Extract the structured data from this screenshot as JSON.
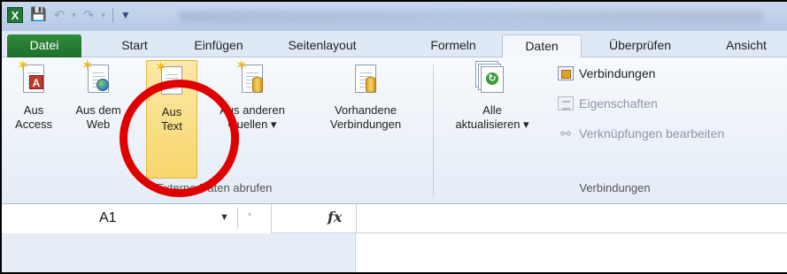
{
  "titlebar": {
    "app_icon": "excel-icon",
    "save_icon": "save-icon",
    "undo_icon": "undo-icon",
    "redo_icon": "redo-icon",
    "customize_icon": "customize-qat-icon"
  },
  "tabs": [
    {
      "label": "Datei"
    },
    {
      "label": "Start"
    },
    {
      "label": "Einfügen"
    },
    {
      "label": "Seitenlayout"
    },
    {
      "label": "Formeln"
    },
    {
      "label": "Daten"
    },
    {
      "label": "Überprüfen"
    },
    {
      "label": "Ansicht"
    }
  ],
  "ribbon": {
    "external_group": {
      "label": "Externe Daten abrufen",
      "buttons": [
        {
          "line1": "Aus",
          "line2": "Access",
          "icon": "access-db-icon"
        },
        {
          "line1": "Aus dem",
          "line2": "Web",
          "icon": "web-icon"
        },
        {
          "line1": "Aus",
          "line2": "Text",
          "icon": "text-file-icon"
        },
        {
          "line1": "Aus anderen",
          "line2": "Quellen ▾",
          "icon": "other-sources-icon"
        },
        {
          "line1": "Vorhandene",
          "line2": "Verbindungen",
          "icon": "existing-connections-icon"
        }
      ]
    },
    "connections_group": {
      "label": "Verbindungen",
      "refresh": {
        "line1": "Alle",
        "line2": "aktualisieren ▾",
        "icon": "refresh-all-icon"
      },
      "small_buttons": [
        {
          "label": "Verbindungen",
          "icon": "connections-icon",
          "enabled": true
        },
        {
          "label": "Eigenschaften",
          "icon": "properties-icon",
          "enabled": false
        },
        {
          "label": "Verknüpfungen bearbeiten",
          "icon": "edit-links-icon",
          "enabled": false
        }
      ]
    }
  },
  "formula_bar": {
    "name_box": "A1",
    "fx": "fx",
    "formula": ""
  },
  "colors": {
    "file_tab": "#2e8b3a",
    "highlight": "#f8d66c",
    "annotation": "#e00000"
  }
}
